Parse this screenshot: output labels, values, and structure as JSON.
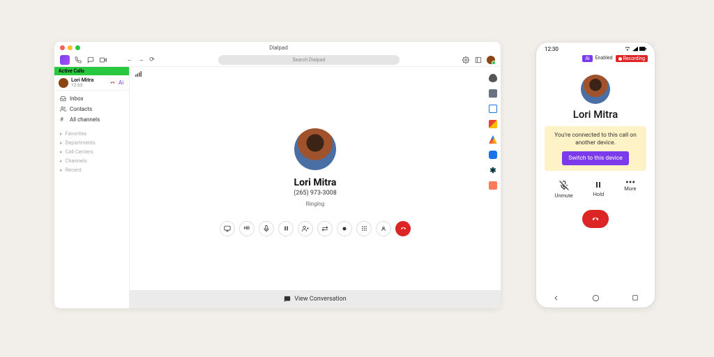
{
  "desktop": {
    "app_title": "Dialpad",
    "search_placeholder": "Search Dialpad",
    "active_calls_header": "Active Calls",
    "active_call": {
      "name": "Lori Mitra",
      "time": "12:53"
    },
    "nav": {
      "inbox": "Inbox",
      "contacts": "Contacts",
      "all_channels": "All channels"
    },
    "groups": {
      "favorites": "Favorites",
      "departments": "Departments",
      "call_centers": "Call Centers",
      "channels": "Channels",
      "recent": "Recent"
    },
    "caller": {
      "name": "Lori Mitra",
      "phone": "(265) 973-3008",
      "status": "Ringing"
    },
    "view_conversation": "View Conversation",
    "integrations": {
      "person": "#555555",
      "safe": "#6b7280",
      "calendar": "#1a73e8",
      "gmail": "#ea4335",
      "drive": "#34a853",
      "messages": "#1a73e8",
      "zendesk": "#03363d",
      "hubspot": "#ff7a59"
    }
  },
  "mobile": {
    "time": "12:30",
    "badge_ai": "Ai",
    "badge_ai_label": "Enabled",
    "badge_rec": "Recording",
    "caller_name": "Lori Mitra",
    "banner_text": "You're connected to this call on another device.",
    "switch_label": "Switch to this device",
    "controls": {
      "unmute": "Unmute",
      "hold": "Hold",
      "more": "More"
    }
  }
}
